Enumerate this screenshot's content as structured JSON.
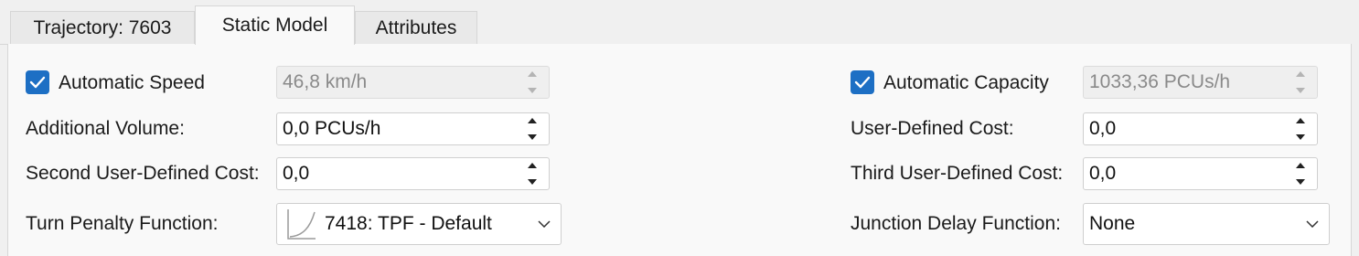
{
  "tabs": [
    {
      "label": "Trajectory: 7603",
      "active": false
    },
    {
      "label": "Static Model",
      "active": true
    },
    {
      "label": "Attributes",
      "active": false
    }
  ],
  "left": {
    "automatic_speed": {
      "label": "Automatic Speed",
      "checked": true,
      "value": "46,8 km/h",
      "disabled": true
    },
    "additional_volume": {
      "label": "Additional Volume:",
      "value": "0,0 PCUs/h"
    },
    "second_user_defined_cost": {
      "label": "Second User-Defined Cost:",
      "value": "0,0"
    },
    "turn_penalty_function": {
      "label": "Turn Penalty Function:",
      "value": "7418: TPF - Default",
      "icon": "curve-icon"
    }
  },
  "right": {
    "automatic_capacity": {
      "label": "Automatic Capacity",
      "checked": true,
      "value": "1033,36 PCUs/h",
      "disabled": true
    },
    "user_defined_cost": {
      "label": "User-Defined Cost:",
      "value": "0,0"
    },
    "third_user_defined_cost": {
      "label": "Third User-Defined Cost:",
      "value": "0,0"
    },
    "junction_delay_function": {
      "label": "Junction Delay Function:",
      "value": "None"
    }
  },
  "colors": {
    "accent": "#1d6fc4",
    "background": "#f0f0f0",
    "panel": "#f9f9f9"
  }
}
